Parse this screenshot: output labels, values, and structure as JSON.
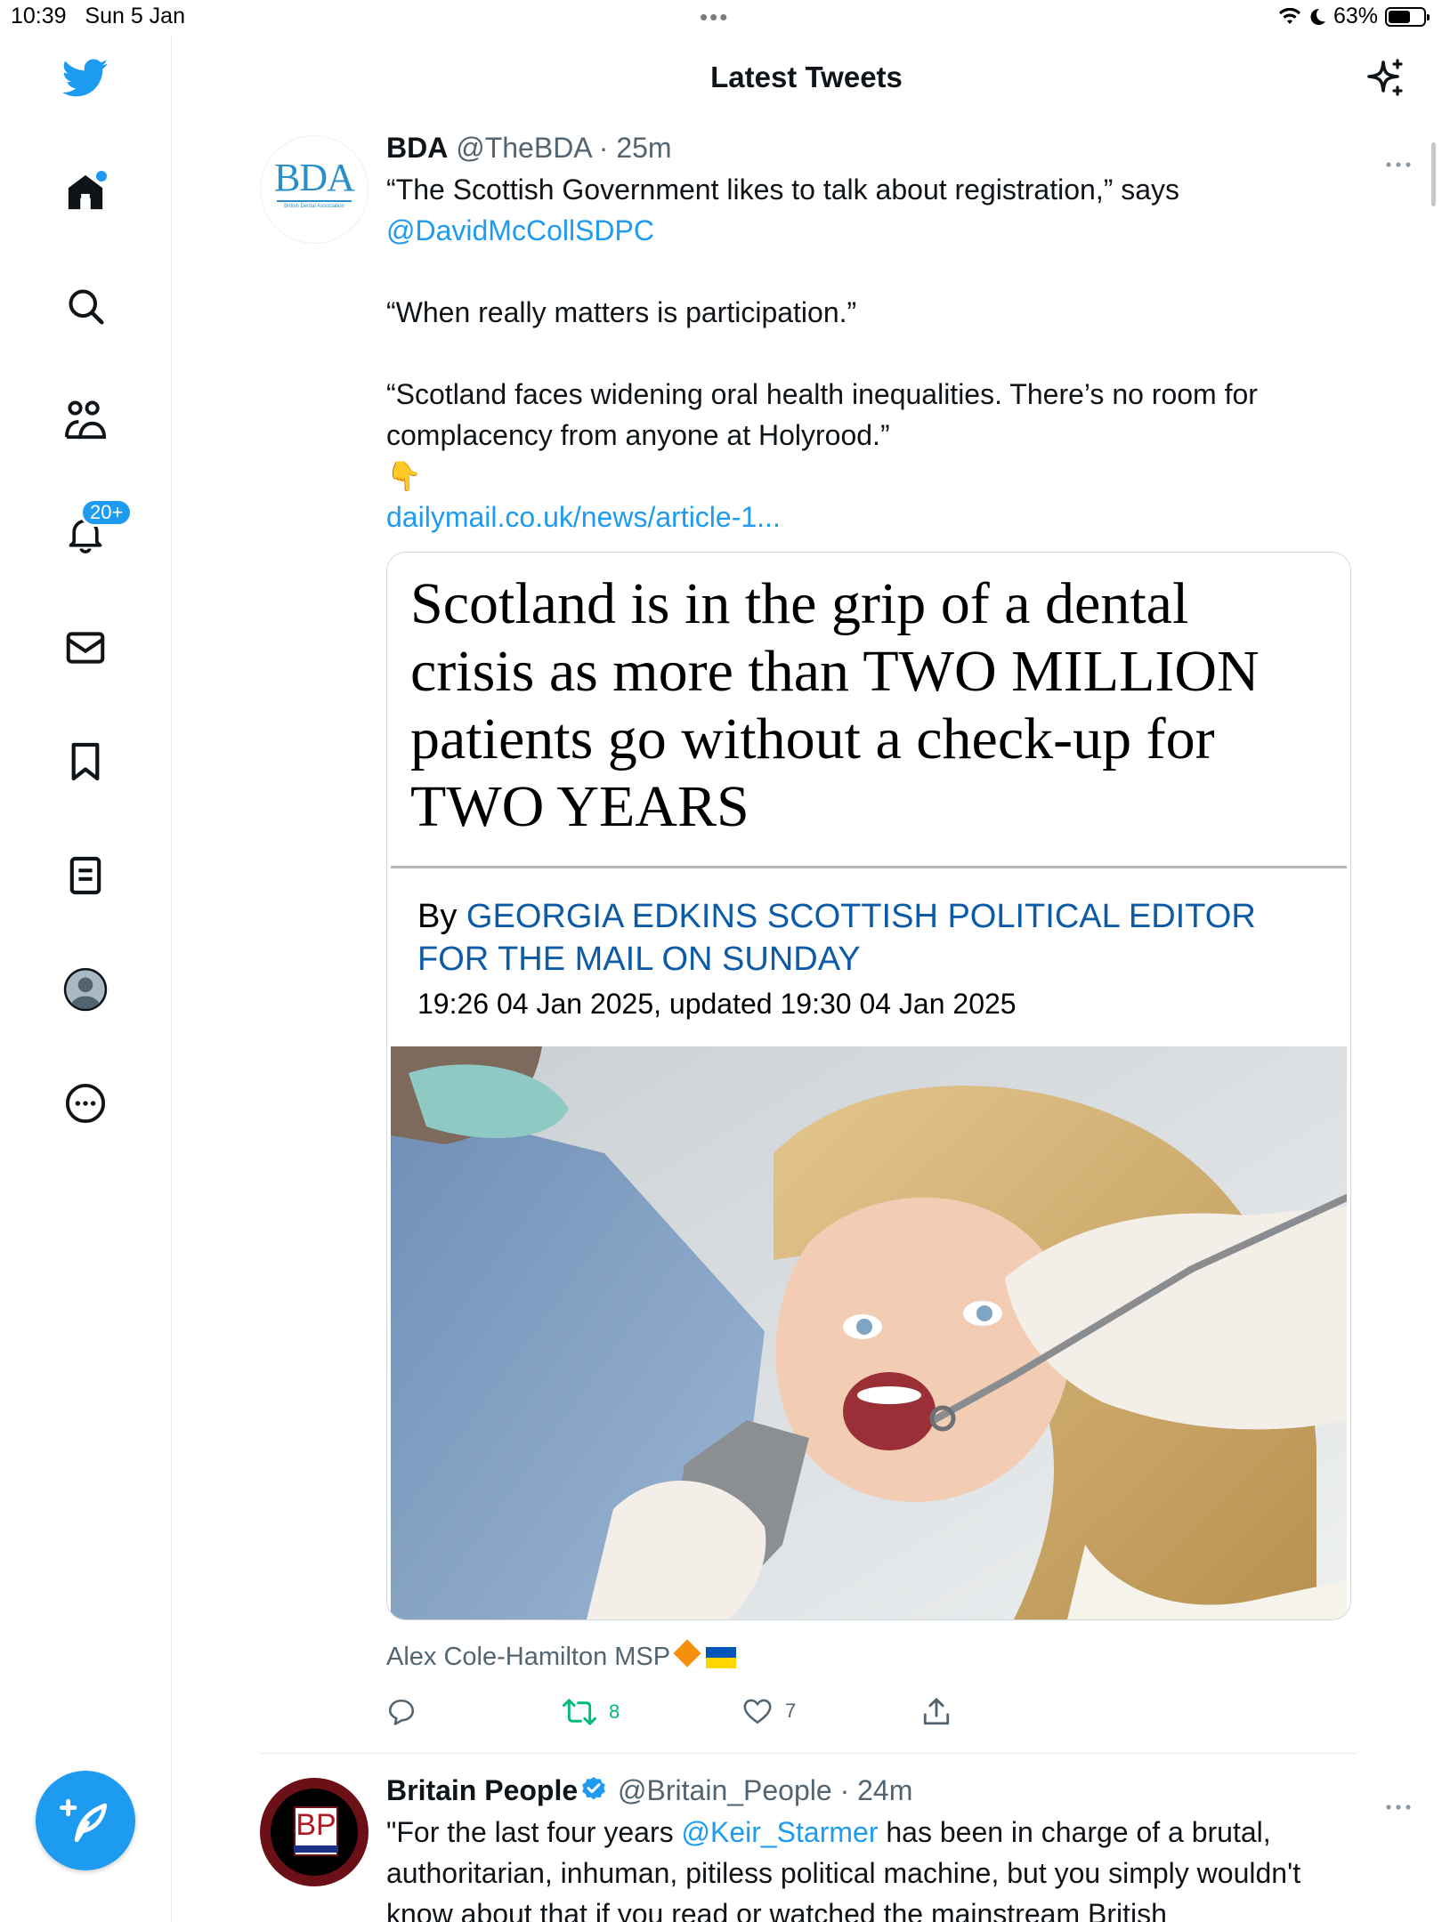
{
  "status_bar": {
    "time": "10:39",
    "date": "Sun 5 Jan",
    "battery": "63%",
    "battery_level": 0.63,
    "multitask": "•••"
  },
  "header": {
    "title": "Latest Tweets"
  },
  "sidebar": {
    "items": [
      {
        "name": "home",
        "icon": "home-icon"
      },
      {
        "name": "search",
        "icon": "search-icon"
      },
      {
        "name": "communities",
        "icon": "people-icon"
      },
      {
        "name": "notifications",
        "icon": "bell-icon",
        "badge": "20+"
      },
      {
        "name": "messages",
        "icon": "envelope-icon"
      },
      {
        "name": "bookmarks",
        "icon": "bookmark-icon"
      },
      {
        "name": "lists",
        "icon": "list-icon"
      },
      {
        "name": "profile",
        "icon": "profile-icon"
      },
      {
        "name": "more",
        "icon": "more-icon"
      }
    ]
  },
  "tweets": [
    {
      "avatar_text": "BDA",
      "avatar_subtext": "British Dental Association",
      "name": "BDA",
      "handle": "@TheBDA",
      "time": "25m",
      "text_line1": "“The Scottish Government likes to talk about registration,” says",
      "mention": "@DavidMcCollSDPC",
      "text_para2": "“When really matters is participation.”",
      "text_para3": "“Scotland faces widening oral health inequalities. There’s no room for complacency from anyone at Holyrood.”",
      "emoji": "👇",
      "link": "dailymail.co.uk/news/article-1...",
      "card": {
        "headline": "Scotland is in the grip of a dental crisis as more than TWO MILLION patients go without a check-up for TWO YEARS",
        "by": "By",
        "author": "GEORGIA EDKINS SCOTTISH POLITICAL EDITOR FOR THE MAIL ON SUNDAY",
        "date": "19:26 04 Jan 2025, updated 19:30 04 Jan 2025"
      },
      "retweeted_by": "Alex Cole-Hamilton MSP",
      "retweets": "8",
      "likes": "7"
    },
    {
      "avatar_text": "BP",
      "name": "Britain People",
      "handle": "@Britain_People",
      "time": "24m",
      "text_start": "\"For the last four years ",
      "mention": "@Keir_Starmer",
      "text_rest": " has been in charge of a brutal, authoritarian, inhuman, pitiless political machine, but you simply wouldn't know about that if you read or watched the mainstream British"
    }
  ],
  "colors": {
    "accent": "#1d9bf0",
    "retweet": "#00ba7c",
    "text": "#0f1419",
    "muted": "#536471"
  }
}
